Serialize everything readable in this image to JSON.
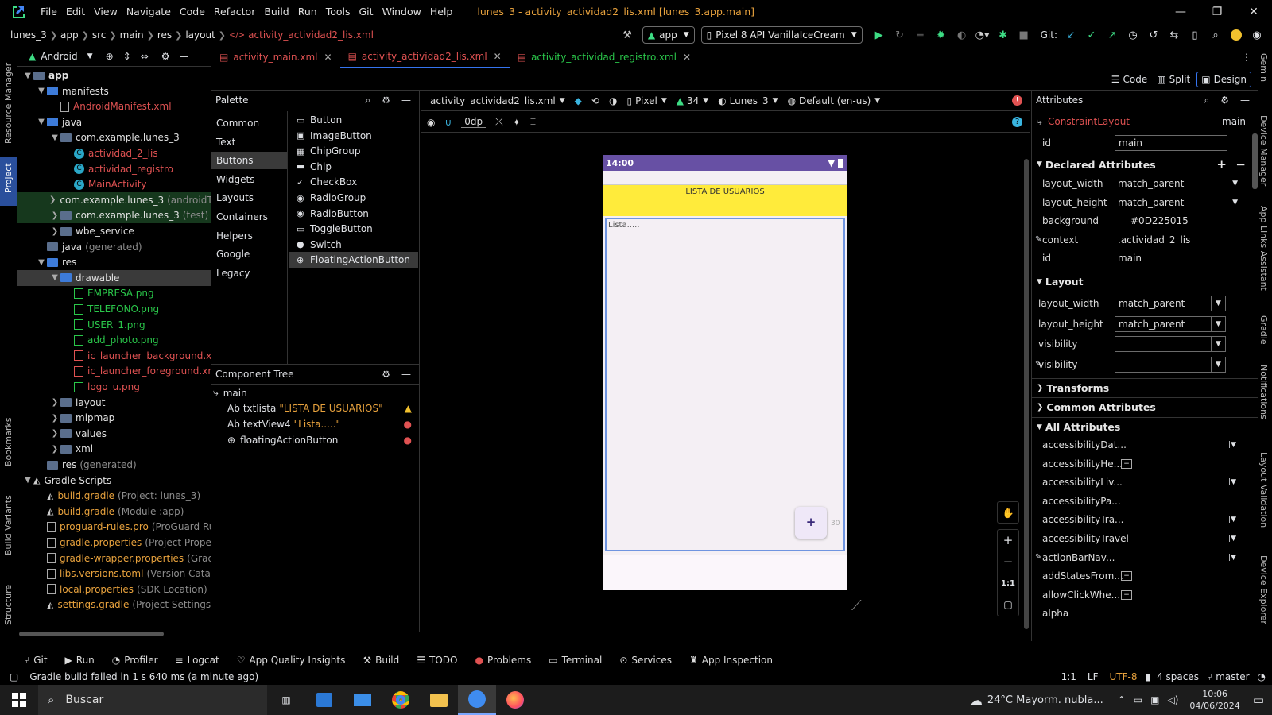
{
  "menubar": {
    "items": [
      "File",
      "Edit",
      "View",
      "Navigate",
      "Code",
      "Refactor",
      "Build",
      "Run",
      "Tools",
      "Git",
      "Window",
      "Help"
    ],
    "title": "lunes_3 - activity_actividad2_lis.xml [lunes_3.app.main]"
  },
  "toolbar": {
    "breadcrumb": [
      "lunes_3",
      "app",
      "src",
      "main",
      "res",
      "layout",
      "activity_actividad2_lis.xml"
    ],
    "run_config": "app",
    "device": "Pixel 8 API VanillaIceCream",
    "git_label": "Git:"
  },
  "left_strip": {
    "top": [
      "Resource Manager",
      "Project"
    ],
    "bottom": [
      "Bookmarks",
      "Build Variants",
      "Structure"
    ]
  },
  "right_strip": [
    "Gemini",
    "Device Manager",
    "App Links Assistant",
    "Gradle",
    "Notifications",
    "Layout Validation",
    "Device Explorer"
  ],
  "project": {
    "view": "Android",
    "tree": [
      {
        "label": "app",
        "kind": "folder",
        "bold": true
      },
      {
        "label": "manifests",
        "kind": "folder"
      },
      {
        "label": "AndroidManifest.xml",
        "kind": "file",
        "color": "red"
      },
      {
        "label": "java",
        "kind": "folder"
      },
      {
        "label": "com.example.lunes_3",
        "kind": "pkg"
      },
      {
        "label": "actividad_2_lis",
        "kind": "class",
        "color": "red"
      },
      {
        "label": "actividad_registro",
        "kind": "class",
        "color": "red"
      },
      {
        "label": "MainActivity",
        "kind": "class",
        "color": "red"
      },
      {
        "label": "com.example.lunes_3",
        "suffix": "(androidTest)",
        "kind": "pkg"
      },
      {
        "label": "com.example.lunes_3",
        "suffix": "(test)",
        "kind": "pkg"
      },
      {
        "label": "wbe_service",
        "kind": "pkg"
      },
      {
        "label": "java",
        "suffix": "(generated)",
        "kind": "folder"
      },
      {
        "label": "res",
        "kind": "folder"
      },
      {
        "label": "drawable",
        "kind": "folder"
      },
      {
        "label": "EMPRESA.png",
        "kind": "img",
        "color": "green"
      },
      {
        "label": "TELEFONO.png",
        "kind": "img",
        "color": "green"
      },
      {
        "label": "USER_1.png",
        "kind": "img",
        "color": "green"
      },
      {
        "label": "add_photo.png",
        "kind": "img",
        "color": "green"
      },
      {
        "label": "ic_launcher_background.xml",
        "kind": "xml",
        "color": "red"
      },
      {
        "label": "ic_launcher_foreground.xml",
        "kind": "xml",
        "color": "red"
      },
      {
        "label": "logo_u.png",
        "kind": "img",
        "color": "red"
      },
      {
        "label": "layout",
        "kind": "folder"
      },
      {
        "label": "mipmap",
        "kind": "folder"
      },
      {
        "label": "values",
        "kind": "folder"
      },
      {
        "label": "xml",
        "kind": "folder"
      },
      {
        "label": "res",
        "suffix": "(generated)",
        "kind": "folder"
      },
      {
        "label": "Gradle Scripts",
        "kind": "gradle"
      },
      {
        "label": "build.gradle",
        "suffix": "(Project: lunes_3)",
        "kind": "gradle",
        "color": "orange"
      },
      {
        "label": "build.gradle",
        "suffix": "(Module :app)",
        "kind": "gradle",
        "color": "orange"
      },
      {
        "label": "proguard-rules.pro",
        "suffix": "(ProGuard Rules",
        "kind": "file",
        "color": "orange"
      },
      {
        "label": "gradle.properties",
        "suffix": "(Project Properties",
        "kind": "file",
        "color": "orange"
      },
      {
        "label": "gradle-wrapper.properties",
        "suffix": "(Gradle",
        "kind": "file",
        "color": "orange"
      },
      {
        "label": "libs.versions.toml",
        "suffix": "(Version Catalog",
        "kind": "file",
        "color": "orange"
      },
      {
        "label": "local.properties",
        "suffix": "(SDK Location)",
        "kind": "file",
        "color": "orange"
      },
      {
        "label": "settings.gradle",
        "suffix": "(Project Settings)",
        "kind": "gradle",
        "color": "orange"
      }
    ]
  },
  "tabs": [
    "activity_main.xml",
    "activity_actividad2_lis.xml",
    "activity_actividad_registro.xml"
  ],
  "view_modes": [
    "Code",
    "Split",
    "Design"
  ],
  "palette": {
    "title": "Palette",
    "categories": [
      "Common",
      "Text",
      "Buttons",
      "Widgets",
      "Layouts",
      "Containers",
      "Helpers",
      "Google",
      "Legacy"
    ],
    "widgets": [
      "Button",
      "ImageButton",
      "ChipGroup",
      "Chip",
      "CheckBox",
      "RadioGroup",
      "RadioButton",
      "ToggleButton",
      "Switch",
      "FloatingActionButton"
    ]
  },
  "component_tree": {
    "title": "Component Tree",
    "root": "main",
    "items": [
      {
        "prefix": "Ab",
        "id": "txtlista",
        "text": "\"LISTA DE USUARIOS\"",
        "status": "warning"
      },
      {
        "prefix": "Ab",
        "id": "textView4",
        "text": "\"Lista.....\"",
        "status": "error"
      },
      {
        "prefix": "+",
        "id": "floatingActionButton",
        "text": "",
        "status": "error"
      }
    ]
  },
  "canvas_toolbar": {
    "file": "activity_actividad2_lis.xml",
    "device": "Pixel",
    "api": "34",
    "theme": "Lunes_3",
    "locale": "Default (en-us)",
    "margin": "0dp"
  },
  "device_preview": {
    "time": "14:00",
    "header_text": "LISTA DE USUARIOS",
    "list_text": "Lista.....",
    "fab_label": "+",
    "header_color": "#FFEB3B",
    "statusbar_color": "#6750A4",
    "margin_label": "30"
  },
  "zoom_controls": [
    "+",
    "−",
    "1:1"
  ],
  "attributes": {
    "title": "Attributes",
    "component": "ConstraintLayout",
    "component_id": "main",
    "id_label": "id",
    "id_value": "main",
    "declared_title": "Declared Attributes",
    "declared": [
      {
        "k": "layout_width",
        "v": "match_parent"
      },
      {
        "k": "layout_height",
        "v": "match_parent"
      },
      {
        "k": "background",
        "v": "#0D225015"
      },
      {
        "k": "context",
        "v": ".actividad_2_lis"
      },
      {
        "k": "id",
        "v": "main"
      }
    ],
    "layout_title": "Layout",
    "layout": [
      {
        "k": "layout_width",
        "v": "match_parent"
      },
      {
        "k": "layout_height",
        "v": "match_parent"
      },
      {
        "k": "visibility",
        "v": ""
      },
      {
        "k": "visibility",
        "v": ""
      }
    ],
    "transforms_title": "Transforms",
    "common_title": "Common Attributes",
    "all_title": "All Attributes",
    "all": [
      "accessibilityDat...",
      "accessibilityHe...",
      "accessibilityLiv...",
      "accessibilityPa...",
      "accessibilityTra...",
      "accessibilityTravel",
      "actionBarNav...",
      "addStatesFrom...",
      "allowClickWhe...",
      "alpha"
    ]
  },
  "toolwindows": [
    "Git",
    "Run",
    "Profiler",
    "Logcat",
    "App Quality Insights",
    "Build",
    "TODO",
    "Problems",
    "Terminal",
    "Services",
    "App Inspection"
  ],
  "status": {
    "message": "Gradle build failed in 1 s 640 ms (a minute ago)",
    "position": "1:1",
    "line_sep": "LF",
    "encoding": "UTF-8",
    "indent": "4 spaces",
    "branch": "master"
  },
  "taskbar": {
    "search": "Buscar",
    "weather": "24°C  Mayorm. nubla...",
    "time": "10:06",
    "date": "04/06/2024"
  }
}
